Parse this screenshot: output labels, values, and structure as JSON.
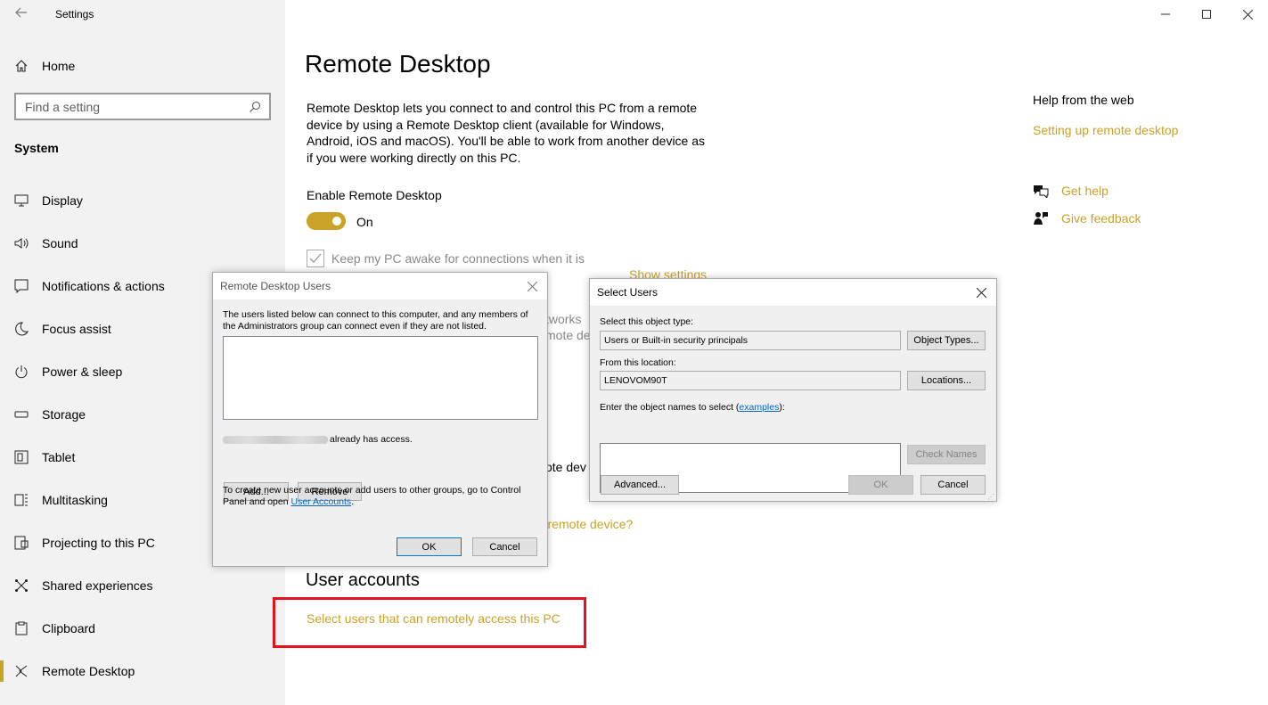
{
  "window": {
    "app_title": "Settings",
    "controls": {
      "minimize_icon": "minimize-icon",
      "maximize_icon": "maximize-icon",
      "close_icon": "close-icon"
    }
  },
  "nav": {
    "home_label": "Home",
    "search_placeholder": "Find a setting",
    "section_title": "System",
    "items": [
      {
        "label": "Display",
        "icon": "display-icon"
      },
      {
        "label": "Sound",
        "icon": "sound-icon"
      },
      {
        "label": "Notifications & actions",
        "icon": "notifications-icon"
      },
      {
        "label": "Focus assist",
        "icon": "moon-icon"
      },
      {
        "label": "Power & sleep",
        "icon": "power-icon"
      },
      {
        "label": "Storage",
        "icon": "storage-icon"
      },
      {
        "label": "Tablet",
        "icon": "tablet-icon"
      },
      {
        "label": "Multitasking",
        "icon": "multitasking-icon"
      },
      {
        "label": "Projecting to this PC",
        "icon": "projecting-icon"
      },
      {
        "label": "Shared experiences",
        "icon": "shared-experiences-icon"
      },
      {
        "label": "Clipboard",
        "icon": "clipboard-icon"
      },
      {
        "label": "Remote Desktop",
        "icon": "remote-desktop-icon",
        "active": true
      }
    ]
  },
  "main": {
    "title": "Remote Desktop",
    "description": "Remote Desktop lets you connect to and control this PC from a remote device by using a Remote Desktop client (available for Windows, Android, iOS and macOS). You'll be able to work from another device as if you were working directly on this PC.",
    "enable_label": "Enable Remote Desktop",
    "toggle_state": "On",
    "keep_awake": "Keep my PC awake for connections when it is",
    "show_settings": "Show settings",
    "frag_networks": "tworks",
    "frag_remote_de": "mote de",
    "frag_remote_dev": "ote dev",
    "frag_remote_device": "r remote device?",
    "user_accounts_title": "User accounts",
    "select_users_link": "Select users that can remotely access this PC",
    "highlight_color": "#e3121c",
    "accent_color": "#c9a227"
  },
  "help": {
    "title": "Help from the web",
    "link": "Setting up remote desktop",
    "get_help": "Get help",
    "give_feedback": "Give feedback"
  },
  "rdu_dialog": {
    "title": "Remote Desktop Users",
    "intro": "The users listed below can connect to this computer, and any members of the Administrators group can connect even if they are not listed.",
    "access_text": "already has access.",
    "add_button": "Add...",
    "remove_button": "Remove",
    "note_prefix": "To create new user accounts or add users to other groups, go to Control Panel and open ",
    "note_link": "User Accounts",
    "note_suffix": ".",
    "ok_button": "OK",
    "cancel_button": "Cancel"
  },
  "su_dialog": {
    "title": "Select Users",
    "object_type_label": "Select this object type:",
    "object_type_value": "Users or Built-in security principals",
    "object_types_button": "Object Types...",
    "location_label": "From this location:",
    "location_value": "LENOVOM90T",
    "locations_button": "Locations...",
    "names_label_prefix": "Enter the object names to select (",
    "names_label_link": "examples",
    "names_label_suffix": "):",
    "names_value": "",
    "check_names_button": "Check Names",
    "advanced_button": "Advanced...",
    "ok_button": "OK",
    "cancel_button": "Cancel"
  }
}
